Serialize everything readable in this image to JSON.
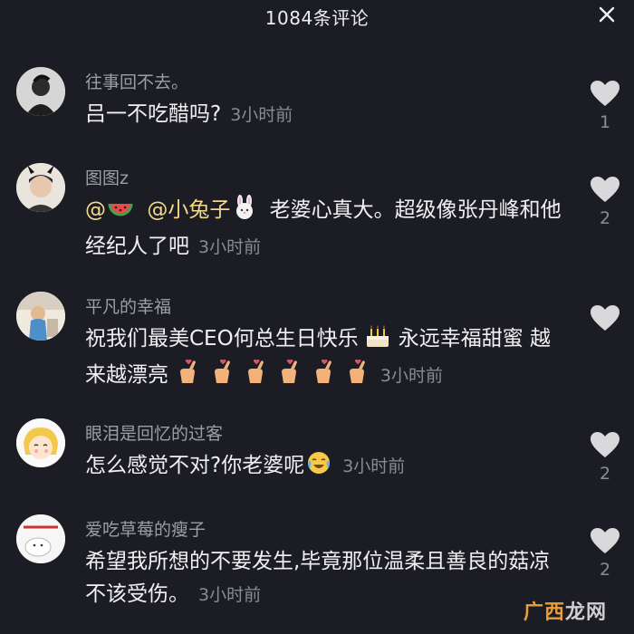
{
  "header": {
    "title": "1084条评论",
    "close_icon": "close-icon"
  },
  "comments": [
    {
      "username": "往事回不去。",
      "text": "吕一不吃醋吗?",
      "time": "3小时前",
      "likes": "1"
    },
    {
      "username": "图图z",
      "mention_prefix": "@",
      "mention": "@小兔子",
      "text": "老婆心真大。超级像张丹峰和他经纪人了吧",
      "time": "3小时前",
      "likes": "2"
    },
    {
      "username": "平凡的幸福",
      "text_a": "祝我们最美CEO何总生日快乐",
      "text_b": "永远幸福甜蜜 越来越漂亮",
      "time": "3小时前",
      "likes": ""
    },
    {
      "username": "眼泪是回忆的过客",
      "text": "怎么感觉不对?你老婆呢",
      "time": "3小时前",
      "likes": "2"
    },
    {
      "username": "爱吃草莓的瘦子",
      "text": "希望我所想的不要发生,毕竟那位温柔且善良的菇凉不该受伤。",
      "time": "3小时前",
      "likes": "2"
    }
  ],
  "watermark": {
    "part1": "广西",
    "part2": "龙网"
  },
  "colors": {
    "background": "#1c1d24",
    "heart": "#d9d9dc"
  }
}
